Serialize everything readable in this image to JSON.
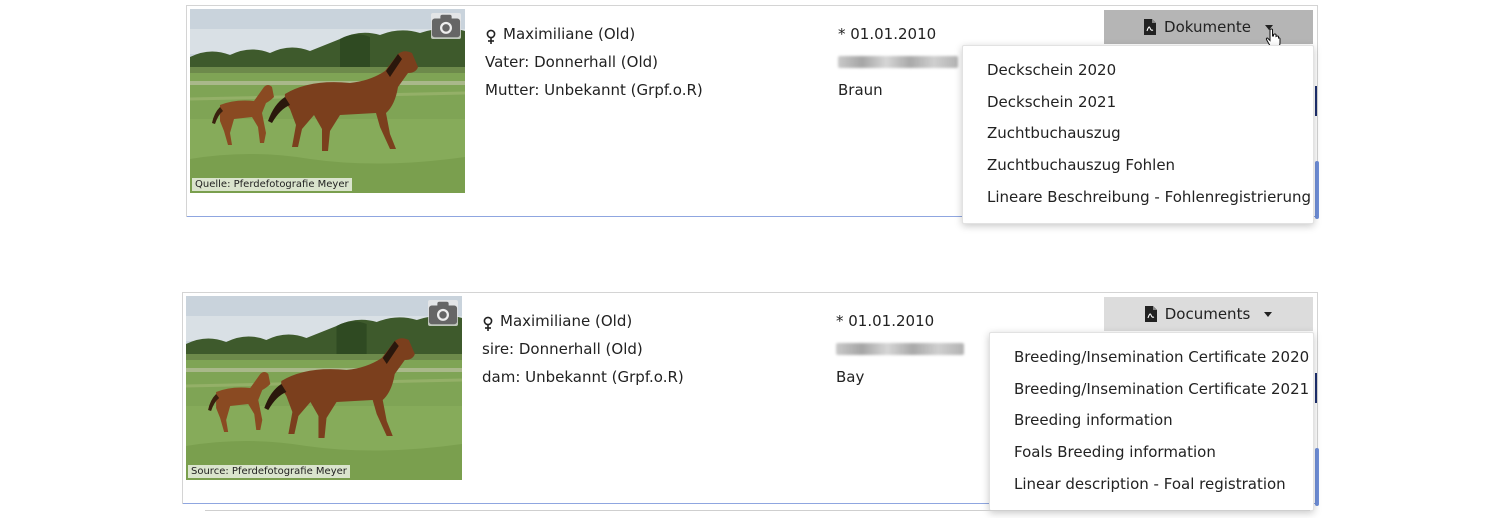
{
  "panels": [
    {
      "photo_source": "Quelle: Pferdefotografie Meyer",
      "name": "Maximiliane (Old)",
      "sire": "Vater: Donnerhall (Old)",
      "dam": "Mutter: Unbekannt (Grpf.o.R)",
      "birth": "* 01.01.2010",
      "color": "Braun",
      "documents_label": "Dokumente",
      "menu_items": [
        "Deckschein 2020",
        "Deckschein 2021",
        "Zuchtbuchauszug",
        "Zuchtbuchauszug Fohlen",
        "Lineare Beschreibung - Fohlenregistrierung"
      ]
    },
    {
      "photo_source": "Source: Pferdefotografie Meyer",
      "name": "Maximiliane (Old)",
      "sire": "sire: Donnerhall (Old)",
      "dam": "dam: Unbekannt (Grpf.o.R)",
      "birth": "* 01.01.2010",
      "color": "Bay",
      "documents_label": "Documents",
      "menu_items": [
        "Breeding/Insemination Certificate 2020",
        "Breeding/Insemination Certificate 2021",
        "Breeding information",
        "Foals Breeding information",
        "Linear description - Foal registration"
      ]
    }
  ],
  "icons": {
    "gender": "female-icon",
    "photo": "camera-icon",
    "document": "pdf-file-icon",
    "dropdown": "caret-down-icon",
    "cursor": "hand-pointer-icon"
  }
}
